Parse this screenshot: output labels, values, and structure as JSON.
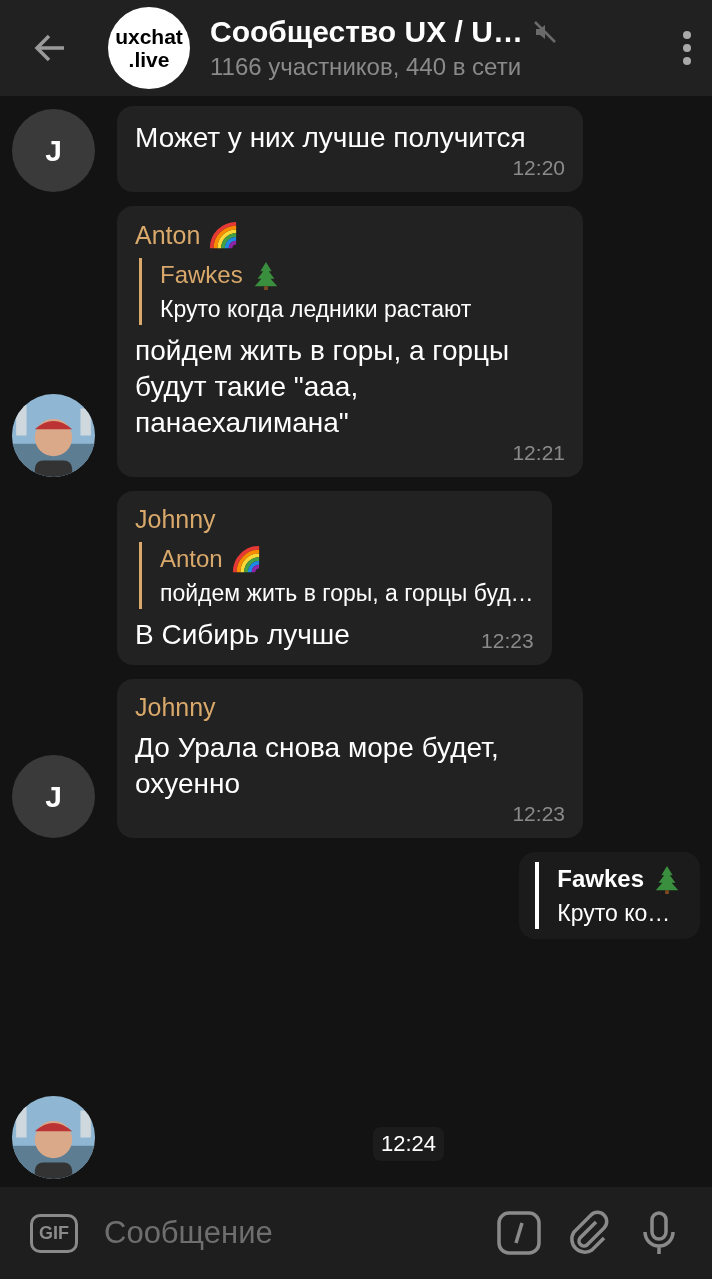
{
  "header": {
    "title": "Сообщество UX / U…",
    "subtitle": "1166 участников, 440 в сети",
    "logo_lines": [
      "uxchat",
      ".live"
    ],
    "muted": true
  },
  "messages": [
    {
      "kind": "incoming",
      "avatar": {
        "kind": "letter",
        "text": "J"
      },
      "text": "Может у них лучше получится",
      "time": "12:20"
    },
    {
      "kind": "incoming",
      "sender": "Anton",
      "badge": {
        "kind": "rainbow"
      },
      "reply": {
        "sender": "Fawkes",
        "badge": {
          "kind": "tree"
        },
        "text": "Круто когда ледники растают"
      },
      "text": "пойдем жить в горы, а горцы будут такие \"ааа, панаехалимана\"",
      "time": "12:21"
    },
    {
      "kind": "incoming",
      "sender": "Johnny",
      "reply": {
        "sender": "Anton",
        "badge": {
          "kind": "rainbow"
        },
        "text": "пойдем жить в горы, а горцы буд…"
      },
      "text": "В Сибирь лучше",
      "time": "12:23"
    },
    {
      "kind": "incoming",
      "sender": "Johnny",
      "avatar": {
        "kind": "letter",
        "text": "J"
      },
      "text": "До Урала снова море будет, охуенно",
      "time": "12:23"
    },
    {
      "kind": "outgoing",
      "reply": {
        "sender": "Fawkes",
        "badge": {
          "kind": "tree"
        },
        "text": "Круто ко…"
      }
    },
    {
      "kind": "sticker",
      "time": "12:24"
    }
  ],
  "composer": {
    "gif_label": "GIF",
    "placeholder": "Сообщение"
  }
}
